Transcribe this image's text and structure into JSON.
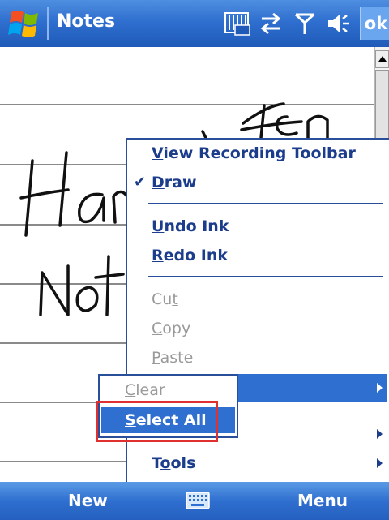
{
  "titlebar": {
    "title": "Notes",
    "ok_label": "ok"
  },
  "menu": {
    "items": [
      {
        "label": "View Recording Toolbar",
        "accel": "V"
      },
      {
        "label": "Draw",
        "accel": "D",
        "checked": true
      },
      {
        "label": "Undo Ink",
        "accel": "U"
      },
      {
        "label": "Redo Ink",
        "accel": "R"
      },
      {
        "label": "Cut",
        "accel": "t"
      },
      {
        "label": "Copy",
        "accel": "C"
      },
      {
        "label": "Paste",
        "accel": "P"
      },
      {
        "label": "Tools",
        "accel": "o"
      }
    ],
    "check_glyph": "✔"
  },
  "submenu": {
    "items": [
      {
        "label": "Clear",
        "accel": "C",
        "enabled": false
      },
      {
        "label": "Select All",
        "accel": "S",
        "enabled": true,
        "selected": true
      }
    ]
  },
  "handwriting": [
    "Handwritten",
    "Notes"
  ],
  "bottombar": {
    "left_softkey": "New",
    "right_softkey": "Menu"
  },
  "colors": {
    "accent": "#2f6fcf",
    "menu_text": "#1b3d8c",
    "annotation": "#e03030"
  }
}
